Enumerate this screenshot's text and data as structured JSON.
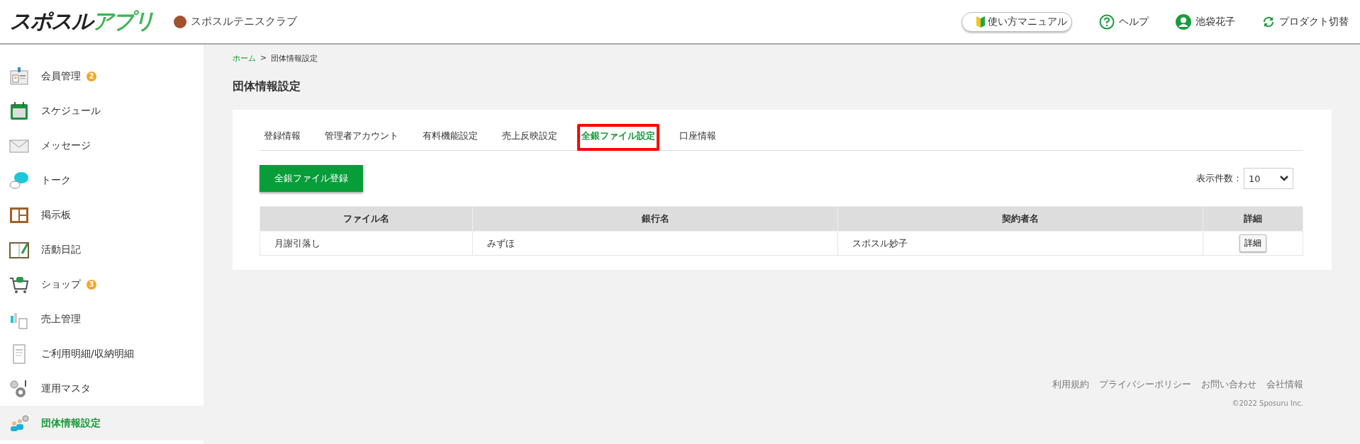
{
  "header": {
    "logo": {
      "main": "スポスル",
      "accent": "アプリ"
    },
    "club": "スポスルテニスクラブ",
    "manual": "使い方マニュアル",
    "help": "ヘルプ",
    "user": "池袋花子",
    "switch": "プロダクト切替"
  },
  "sidebar": {
    "items": [
      {
        "kind": "member",
        "label": "会員管理",
        "badge": "2",
        "selected": false
      },
      {
        "kind": "calendar",
        "label": "スケジュール",
        "selected": false
      },
      {
        "kind": "mail",
        "label": "メッセージ",
        "selected": false
      },
      {
        "kind": "talk",
        "label": "トーク",
        "selected": false
      },
      {
        "kind": "board",
        "label": "掲示板",
        "selected": false
      },
      {
        "kind": "diary",
        "label": "活動日記",
        "selected": false
      },
      {
        "kind": "shop",
        "label": "ショップ",
        "badge": "3",
        "selected": false
      },
      {
        "kind": "sales",
        "label": "売上管理",
        "selected": false
      },
      {
        "kind": "receipt",
        "label": "ご利用明細/収納明細",
        "selected": false
      },
      {
        "kind": "gear",
        "label": "運用マスタ",
        "selected": false
      },
      {
        "kind": "group",
        "label": "団体情報設定",
        "selected": true
      }
    ]
  },
  "breadcrumb": [
    {
      "label": "ホーム",
      "link": true
    },
    {
      "label": ">",
      "link": false
    },
    {
      "label": "団体情報設定",
      "link": false
    }
  ],
  "title": "団体情報設定",
  "tabs": [
    {
      "label": "登録情報",
      "selected": false,
      "highlighted": false
    },
    {
      "label": "管理者アカウント",
      "selected": false,
      "highlighted": false
    },
    {
      "label": "有料機能設定",
      "selected": false,
      "highlighted": false
    },
    {
      "label": "売上反映設定",
      "selected": false,
      "highlighted": false
    },
    {
      "label": "全銀ファイル設定",
      "selected": true,
      "highlighted": true
    },
    {
      "label": "口座情報",
      "selected": false,
      "highlighted": false
    }
  ],
  "register_button": "全銀ファイル登録",
  "page_size": {
    "label": "表示件数：",
    "value": "10"
  },
  "table": {
    "columns": [
      "ファイル名",
      "銀行名",
      "契約者名",
      "詳細"
    ],
    "rows": [
      {
        "cells": [
          "月謝引落し",
          "みずほ",
          "スポスル妙子"
        ],
        "action": "詳細"
      }
    ]
  },
  "footer": {
    "links": [
      "利用規約",
      "プライバシーポリシー",
      "お問い合わせ",
      "会社情報"
    ],
    "copyright": "©2022 Sposuru Inc."
  }
}
